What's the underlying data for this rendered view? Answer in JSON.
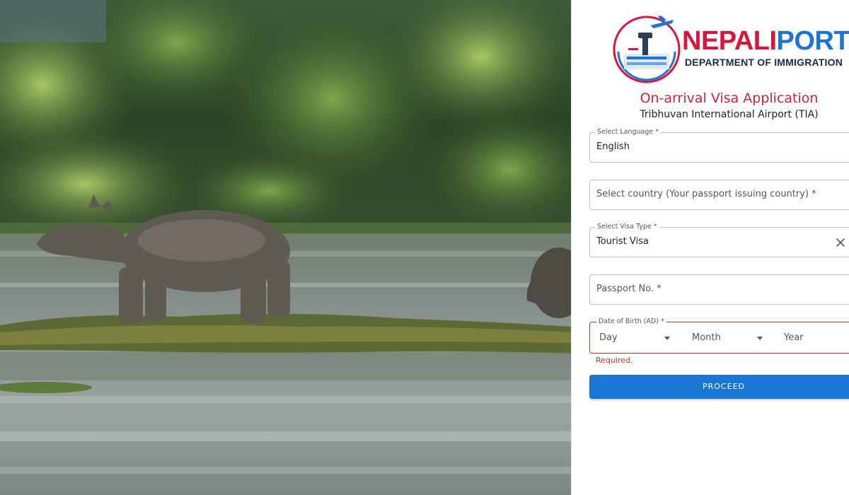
{
  "brand": {
    "name_part1": "NEPALI",
    "name_part2": "PORT",
    "department": "DEPARTMENT OF IMMIGRATION",
    "logo_icon": "airport-plane-emblem-icon",
    "colors": {
      "red": "#d8163b",
      "blue": "#1e73d6",
      "navy": "#1a2a4a"
    }
  },
  "hero": {
    "image": "rhinoceros-river-scene-photo"
  },
  "form": {
    "title": "On-arrival Visa Application",
    "subtitle": "Tribhuvan International Airport (TIA)",
    "language": {
      "label": "Select Language *",
      "value": "English"
    },
    "country": {
      "placeholder": "Select country (Your passport issuing country) *"
    },
    "visa_type": {
      "label": "Select Visa Type *",
      "value": "Tourist Visa",
      "clear_icon": "close-icon"
    },
    "passport": {
      "placeholder": "Passport No. *"
    },
    "dob": {
      "label": "Date of Birth (AD) *",
      "day": "Day",
      "month": "Month",
      "year": "Year",
      "error": "Required."
    },
    "proceed_label": "PROCEED",
    "colors": {
      "accent": "#1976d2",
      "error": "#d32f2f",
      "title": "#d21f3c"
    }
  }
}
